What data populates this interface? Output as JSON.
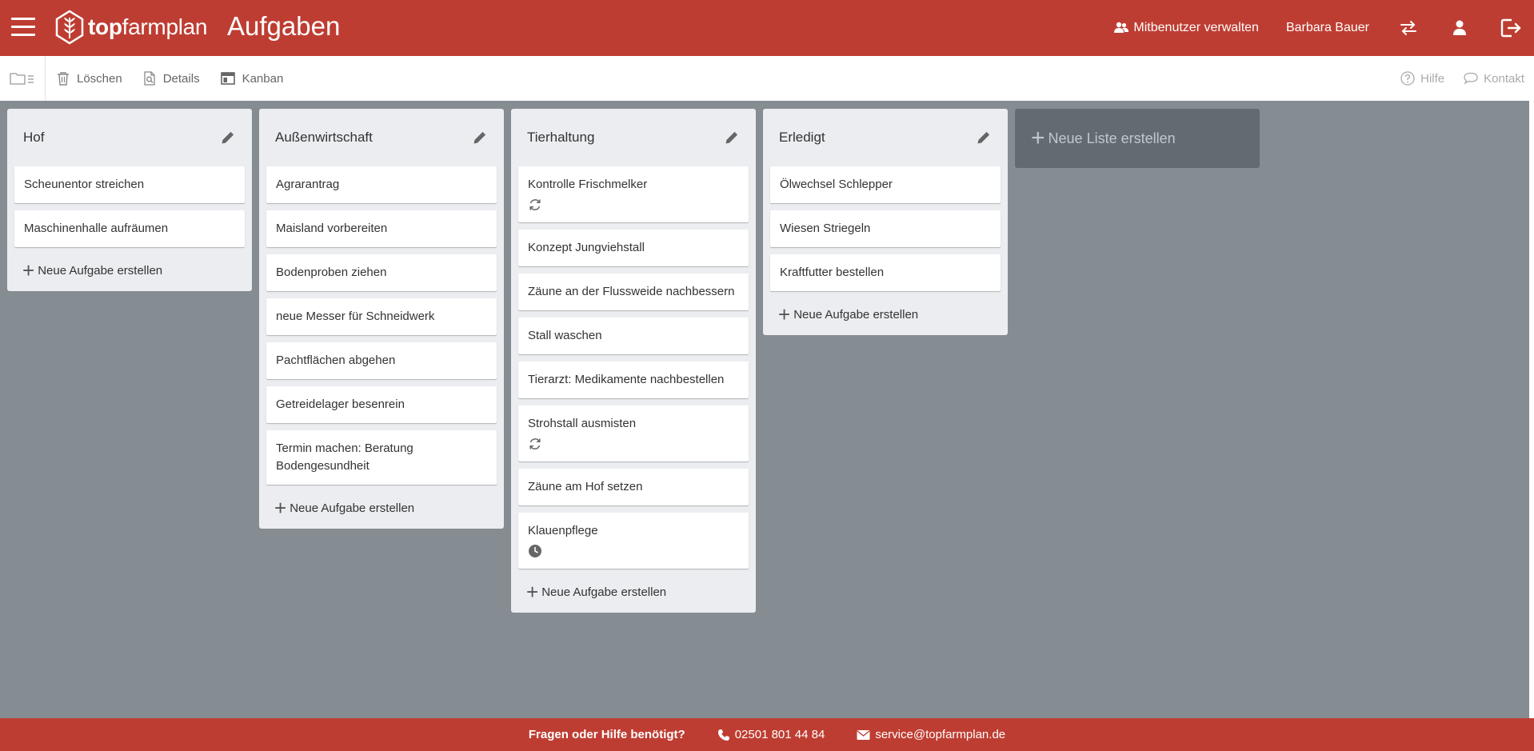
{
  "header": {
    "logo_bold": "top",
    "logo_rest": "farmplan",
    "page_title": "Aufgaben",
    "manage_users_label": "Mitbenutzer verwalten",
    "user_name": "Barbara Bauer"
  },
  "toolbar": {
    "delete_label": "Löschen",
    "details_label": "Details",
    "kanban_label": "Kanban",
    "help_label": "Hilfe",
    "contact_label": "Kontakt"
  },
  "board": {
    "add_task_label": "Neue Aufgabe erstellen",
    "new_list_label": "Neue Liste erstellen",
    "columns": [
      {
        "title": "Hof",
        "cards": [
          {
            "text": "Scheunentor streichen"
          },
          {
            "text": "Maschinenhalle aufräumen"
          }
        ]
      },
      {
        "title": "Außenwirtschaft",
        "cards": [
          {
            "text": "Agrarantrag"
          },
          {
            "text": "Maisland vorbereiten"
          },
          {
            "text": "Bodenproben ziehen"
          },
          {
            "text": "neue Messer für Schneidwerk"
          },
          {
            "text": "Pachtflächen abgehen"
          },
          {
            "text": "Getreidelager besenrein"
          },
          {
            "text": "Termin machen: Beratung Bodengesundheit"
          }
        ]
      },
      {
        "title": "Tierhaltung",
        "cards": [
          {
            "text": "Kontrolle Frischmelker",
            "icon": "repeat-icon"
          },
          {
            "text": "Konzept Jungviehstall"
          },
          {
            "text": "Zäune an der Flussweide nachbessern"
          },
          {
            "text": "Stall waschen"
          },
          {
            "text": "Tierarzt: Medikamente nachbestellen"
          },
          {
            "text": "Strohstall ausmisten",
            "icon": "repeat-icon"
          },
          {
            "text": "Zäune am Hof setzen"
          },
          {
            "text": "Klauenpflege",
            "icon": "clock-icon"
          }
        ]
      },
      {
        "title": "Erledigt",
        "cards": [
          {
            "text": "Ölwechsel Schlepper"
          },
          {
            "text": "Wiesen Striegeln"
          },
          {
            "text": "Kraftfutter bestellen"
          }
        ]
      }
    ]
  },
  "footer": {
    "question": "Fragen oder Hilfe benötigt?",
    "phone": "02501 801 44 84",
    "email": "service@topfarmplan.de"
  },
  "colors": {
    "brand_red": "#be3d32",
    "board_bg": "#858c92",
    "column_bg": "#ebedf0",
    "new_list_bg": "#636b72"
  }
}
